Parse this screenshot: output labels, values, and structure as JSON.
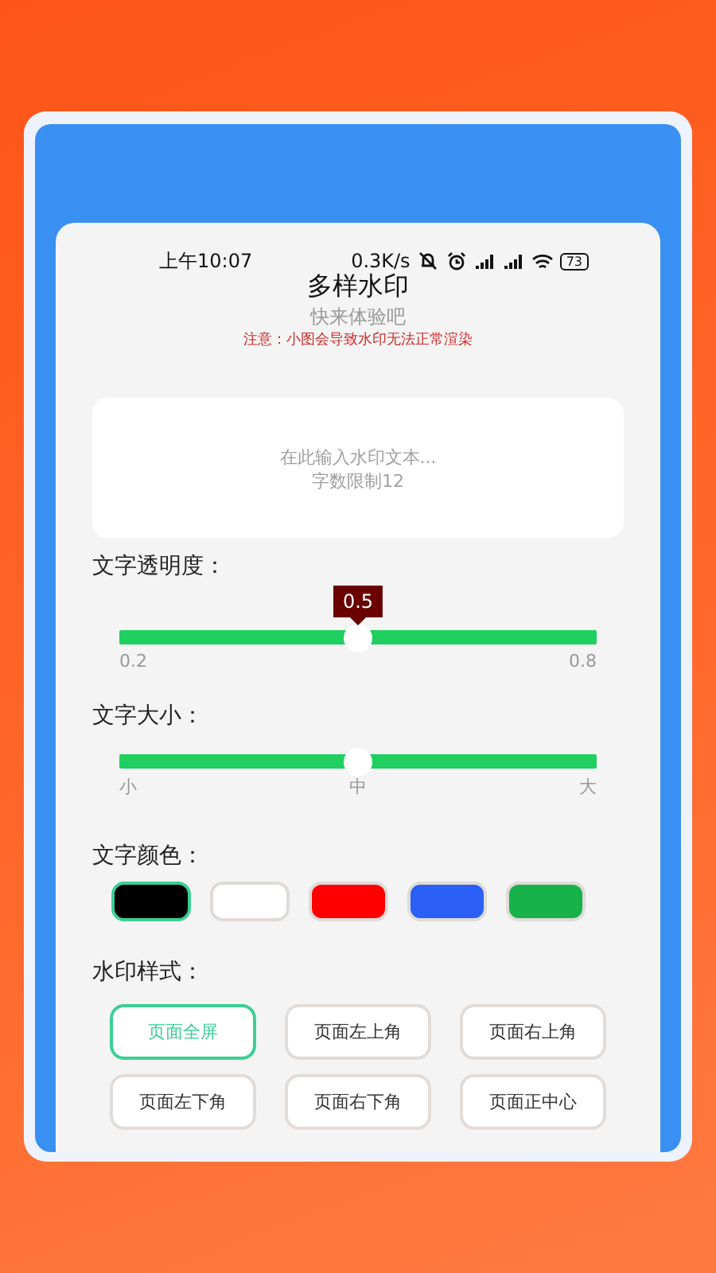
{
  "status_bar": {
    "time": "上午10:07",
    "speed": "0.3K/s",
    "battery": "73"
  },
  "header": {
    "title": "多样水印",
    "subtitle": "快来体验吧",
    "notice": "注意：小图会导致水印无法正常渲染"
  },
  "text_input": {
    "placeholder": "在此输入水印文本...\n字数限制12"
  },
  "sliders": [
    {
      "label": "文字透明度：",
      "level": 0.5,
      "reading": "0.5",
      "ticks": [
        "0.2",
        "0.8"
      ]
    },
    {
      "label": "文字大小：",
      "level": 0.5,
      "ticks": [
        "小",
        "中",
        "大"
      ]
    }
  ],
  "text_color": {
    "label": "文字颜色：",
    "swatches": [
      {
        "color": "#000000",
        "selected": true
      },
      {
        "color": "#ffffff",
        "selected": false
      },
      {
        "color": "#ff0000",
        "selected": false
      },
      {
        "color": "#2b5ff5",
        "selected": false
      },
      {
        "color": "#17b24a",
        "selected": false
      }
    ]
  },
  "watermark_style": {
    "label": "水印样式：",
    "options": [
      {
        "label": "页面全屏",
        "selected": true
      },
      {
        "label": "页面左上角",
        "selected": false
      },
      {
        "label": "页面右上角",
        "selected": false
      },
      {
        "label": "页面左下角",
        "selected": false
      },
      {
        "label": "页面右下角",
        "selected": false
      },
      {
        "label": "页面正中心",
        "selected": false
      }
    ]
  }
}
